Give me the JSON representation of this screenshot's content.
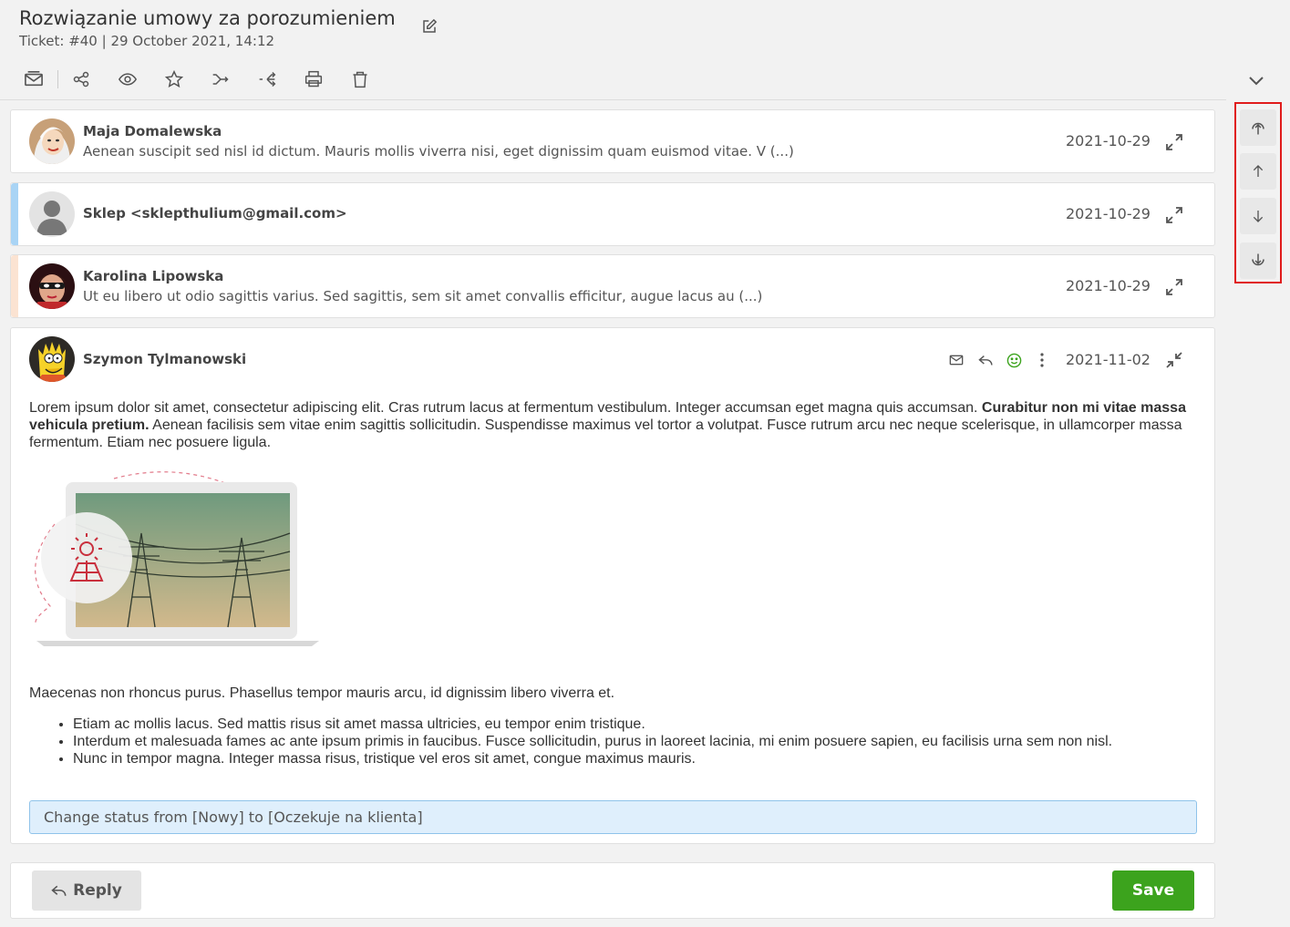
{
  "ticket": {
    "title": "Rozwiązanie umowy za porozumieniem",
    "subtitle": "Ticket: #40 | 29 October 2021, 14:12"
  },
  "toolbar": {
    "icons": [
      "envelope-icon",
      "share-icon",
      "eye-icon",
      "star-icon",
      "forward-icon",
      "split-icon",
      "print-icon",
      "trash-icon"
    ]
  },
  "messages": [
    {
      "sender": "Maja Domalewska",
      "preview": "Aenean suscipit sed nisl id dictum. Mauris mollis viverra nisi, eget dignissim quam euismod vitae. V (...)",
      "date": "2021-10-29"
    },
    {
      "sender": "Sklep <sklepthulium@gmail.com>",
      "preview": "",
      "date": "2021-10-29",
      "accent_color": "#a9d4f5"
    },
    {
      "sender": "Karolina Lipowska",
      "preview": "Ut eu libero ut odio sagittis varius. Sed sagittis, sem sit amet convallis efficitur, augue lacus au (...)",
      "date": "2021-10-29",
      "accent_color": "#fbe3d2"
    }
  ],
  "open_message": {
    "sender": "Szymon Tylmanowski",
    "date": "2021-11-02",
    "para1_a": "Lorem ipsum dolor sit amet, consectetur adipiscing elit. Cras rutrum lacus at fermentum vestibulum. Integer accumsan eget magna quis accumsan. ",
    "para1_bold": "Curabitur non mi vitae massa vehicula pretium.",
    "para1_b": " Aenean facilisis sem vitae enim sagittis sollicitudin. Suspendisse maximus vel tortor a volutpat. Fusce rutrum arcu nec neque scelerisque, in ullamcorper massa fermentum. Etiam nec posuere ligula.",
    "para2": "Maecenas non rhoncus purus. Phasellus tempor mauris arcu, id dignissim libero viverra et.",
    "bullets": [
      "Etiam ac mollis lacus. Sed mattis risus sit amet massa ultricies, eu tempor enim tristique.",
      "Interdum et malesuada fames ac ante ipsum primis in faucibus. Fusce sollicitudin, purus in laoreet lacinia, mi enim posuere sapien, eu facilisis urna sem non nisl.",
      "Nunc in tempor magna. Integer massa risus, tristique vel eros sit amet, congue maximus mauris."
    ],
    "status_note": "Change status from [Nowy] to [Oczekuje na klienta]"
  },
  "footer": {
    "reply_label": "Reply",
    "save_label": "Save"
  },
  "colors": {
    "save": "#3ca31d",
    "highlight_frame": "#e01b1b",
    "status_bg": "#dfeffc"
  }
}
